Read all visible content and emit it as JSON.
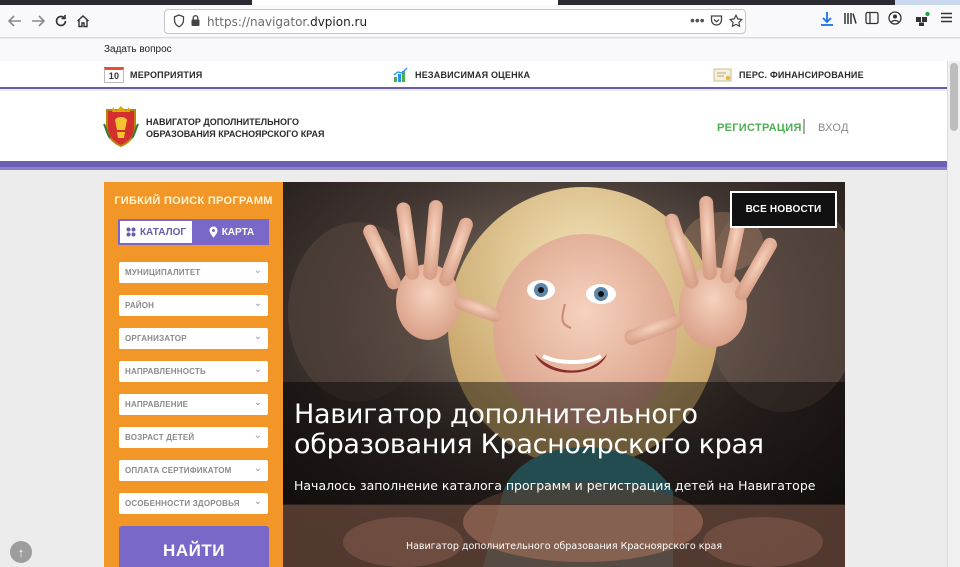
{
  "browser": {
    "url_prefix": "https://navigator.",
    "url_host": "dvpion.ru",
    "bookmark": "Задать вопрос"
  },
  "topnav": {
    "calendar_day": "10",
    "items": [
      "МЕРОПРИЯТИЯ",
      "НЕЗАВИСИМАЯ ОЦЕНКА",
      "ПЕРС. ФИНАНСИРОВАНИЕ"
    ]
  },
  "header": {
    "logo_line1": "НАВИГАТОР ДОПОЛНИТЕЛЬНОГО",
    "logo_line2": "ОБРАЗОВАНИЯ КРАСНОЯРСКОГО КРАЯ",
    "register": "РЕГИСТРАЦИЯ",
    "login": "ВХОД"
  },
  "search": {
    "title": "ГИБКИЙ ПОИСК ПРОГРАММ",
    "catalog": "КАТАЛОГ",
    "map": "КАРТА",
    "filters": [
      "МУНИЦИПАЛИТЕТ",
      "РАЙОН",
      "ОРГАНИЗАТОР",
      "НАПРАВЛЕННОСТЬ",
      "НАПРАВЛЕНИЕ",
      "ВОЗРАСТ ДЕТЕЙ",
      "ОПЛАТА СЕРТИФИКАТОМ",
      "ОСОБЕННОСТИ ЗДОРОВЬЯ"
    ],
    "find": "НАЙТИ"
  },
  "hero": {
    "news_button": "ВСЕ НОВОСТИ",
    "title": "Навигатор дополнительного образования Красноярского края",
    "subtitle": "Началось заполнение каталога программ и регистрация детей на Навигаторе",
    "caption": "Навигатор дополнительного образования Красноярского края"
  },
  "colors": {
    "accent_orange": "#f29727",
    "accent_purple": "#7a68c8",
    "register_green": "#4caf50"
  },
  "icons": [
    "back-icon",
    "forward-icon",
    "reload-icon",
    "home-icon",
    "shield-icon",
    "lock-icon",
    "more-icon",
    "pocket-icon",
    "star-icon",
    "download-icon",
    "library-icon",
    "sidebar-icon",
    "account-icon",
    "extensions-icon",
    "menu-icon",
    "calendar-icon",
    "chart-icon",
    "certificate-icon",
    "coat-of-arms-icon",
    "grid-icon",
    "map-pin-icon",
    "chevron-down-icon",
    "arrow-up-icon"
  ]
}
